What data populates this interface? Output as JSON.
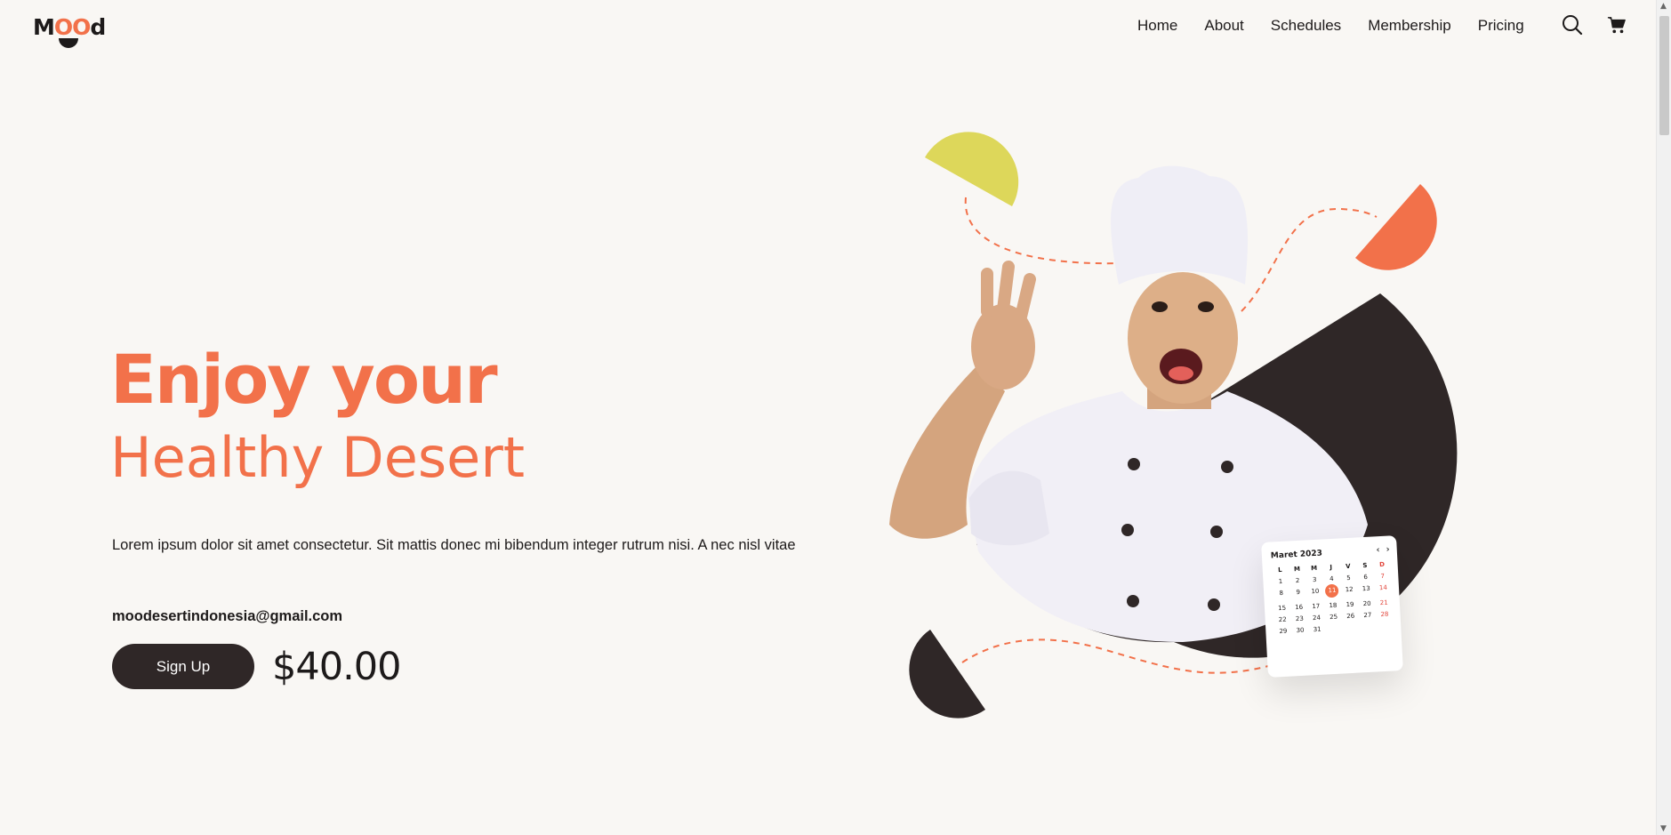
{
  "brand": {
    "logo_parts": [
      "M",
      "OO",
      "d"
    ],
    "accent_color": "#f2714a",
    "dark_color": "#2f2727",
    "yellow_color": "#ddd75a"
  },
  "nav": {
    "items": [
      {
        "label": "Home"
      },
      {
        "label": "About"
      },
      {
        "label": "Schedules"
      },
      {
        "label": "Membership"
      },
      {
        "label": "Pricing"
      }
    ],
    "search_icon": "search-icon",
    "cart_icon": "cart-icon"
  },
  "hero": {
    "title_line1": "Enjoy your",
    "title_line2": "Healthy Desert",
    "description": "Lorem ipsum dolor sit amet consectetur. Sit mattis donec mi bibendum integer rutrum nisi. A nec nisl vitae",
    "email": "moodesertindonesia@gmail.com",
    "signup_label": "Sign Up",
    "price": "$40.00"
  },
  "calendar": {
    "month_label": "Maret 2023",
    "weekdays": [
      "L",
      "M",
      "M",
      "J",
      "V",
      "S",
      "D"
    ],
    "days": [
      "1",
      "2",
      "3",
      "4",
      "5",
      "6",
      "7",
      "8",
      "9",
      "10",
      "11",
      "12",
      "13",
      "14",
      "15",
      "16",
      "17",
      "18",
      "19",
      "20",
      "21",
      "22",
      "23",
      "24",
      "25",
      "26",
      "27",
      "28",
      "29",
      "30",
      "31"
    ],
    "selected_day": "11",
    "prev_icon": "chevron-left-icon",
    "next_icon": "chevron-right-icon"
  }
}
